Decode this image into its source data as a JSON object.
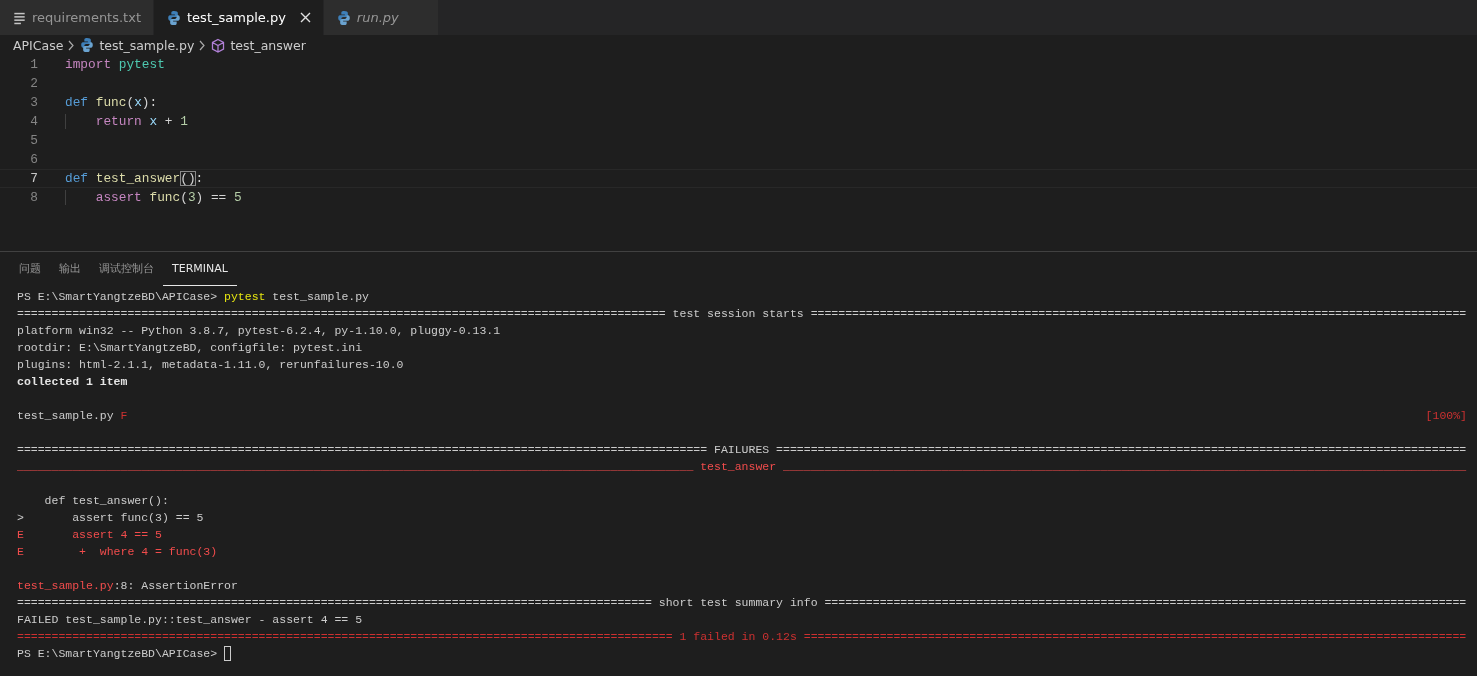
{
  "tabs": [
    {
      "label": "requirements.txt",
      "kind": "text",
      "selected": false,
      "preview": false,
      "closable": false
    },
    {
      "label": "test_sample.py",
      "kind": "python",
      "selected": true,
      "preview": false,
      "closable": true
    },
    {
      "label": "run.py",
      "kind": "python",
      "selected": false,
      "preview": true,
      "closable": false
    }
  ],
  "breadcrumbs": [
    {
      "label": "APICase",
      "kind": "folder"
    },
    {
      "label": "test_sample.py",
      "kind": "python"
    },
    {
      "label": "test_answer",
      "kind": "symbol"
    }
  ],
  "code_lines": [
    {
      "number": "1",
      "current": false,
      "tokens": [
        {
          "kind": "keyword",
          "text": "import "
        },
        {
          "kind": "module",
          "text": "pytest"
        }
      ]
    },
    {
      "number": "2",
      "current": false
    },
    {
      "number": "3",
      "current": false,
      "tokens": [
        {
          "kind": "storage",
          "text": "def "
        },
        {
          "kind": "function",
          "text": "func"
        },
        {
          "kind": "plain",
          "text": "("
        },
        {
          "kind": "param",
          "text": "x"
        },
        {
          "kind": "plain",
          "text": "):"
        }
      ]
    },
    {
      "number": "4",
      "current": false,
      "tokens": [
        {
          "kind": "indented-keyword",
          "text": "    return "
        },
        {
          "kind": "param",
          "text": "x"
        },
        {
          "kind": "plain",
          "text": " + "
        },
        {
          "kind": "number",
          "text": "1"
        }
      ]
    },
    {
      "number": "5",
      "current": false
    },
    {
      "number": "6",
      "current": false
    },
    {
      "number": "7",
      "current": true,
      "tokens": [
        {
          "kind": "storage",
          "text": "def "
        },
        {
          "kind": "function",
          "text": "test_answer"
        },
        {
          "kind": "bracket-match",
          "text": "()"
        },
        {
          "kind": "plain",
          "text": ":"
        }
      ]
    },
    {
      "number": "8",
      "current": false,
      "tokens": [
        {
          "kind": "indented-keyword",
          "text": "    assert "
        },
        {
          "kind": "function",
          "text": "func"
        },
        {
          "kind": "plain",
          "text": "("
        },
        {
          "kind": "number",
          "text": "3"
        },
        {
          "kind": "plain",
          "text": ") == "
        },
        {
          "kind": "number",
          "text": "5"
        }
      ]
    }
  ],
  "panel_tabs": [
    {
      "label": "问题",
      "selected": false
    },
    {
      "label": "输出",
      "selected": false
    },
    {
      "label": "调试控制台",
      "selected": false
    },
    {
      "label": "TERMINAL",
      "selected": true
    }
  ],
  "terminal_lines": [
    {
      "kind": "prompt",
      "cursor": false,
      "segments": [
        {
          "kind": "plain",
          "text": "PS E:\\SmartYangtzeBD\\APICase> "
        },
        {
          "kind": "yellow",
          "text": "pytest"
        },
        {
          "kind": "plain",
          "text": " test_sample.py"
        }
      ]
    },
    {
      "kind": "text",
      "segments": [
        {
          "kind": "plain",
          "text": "============================================================================================== test session starts ==============================================================================================="
        }
      ]
    },
    {
      "kind": "text",
      "segments": [
        {
          "kind": "plain",
          "text": "platform win32 -- Python 3.8.7, pytest-6.2.4, py-1.10.0, pluggy-0.13.1"
        }
      ]
    },
    {
      "kind": "text",
      "segments": [
        {
          "kind": "plain",
          "text": "rootdir: E:\\SmartYangtzeBD, configfile: pytest.ini"
        }
      ]
    },
    {
      "kind": "text",
      "segments": [
        {
          "kind": "plain",
          "text": "plugins: html-2.1.1, metadata-1.11.0, rerunfailures-10.0"
        }
      ]
    },
    {
      "kind": "text",
      "segments": [
        {
          "kind": "bold",
          "text": "collected 1 item"
        }
      ]
    },
    {
      "kind": "blank"
    },
    {
      "kind": "text",
      "segments": [
        {
          "kind": "plain",
          "text": "test_sample.py "
        },
        {
          "kind": "red",
          "text": "F"
        }
      ],
      "right": [
        {
          "kind": "red",
          "text": "[100%]"
        }
      ]
    },
    {
      "kind": "blank"
    },
    {
      "kind": "text",
      "segments": [
        {
          "kind": "plain",
          "text": "==================================================================================================== FAILURES ===================================================================================================="
        }
      ]
    },
    {
      "kind": "text",
      "segments": [
        {
          "kind": "bright-red",
          "text": "__________________________________________________________________________________________________ test_answer ___________________________________________________________________________________________________"
        }
      ]
    },
    {
      "kind": "blank"
    },
    {
      "kind": "text",
      "segments": [
        {
          "kind": "plain",
          "text": "    def test_answer():"
        }
      ]
    },
    {
      "kind": "text",
      "segments": [
        {
          "kind": "plain",
          "text": ">       assert func(3) == 5"
        }
      ]
    },
    {
      "kind": "text",
      "segments": [
        {
          "kind": "bright-red",
          "text": "E       assert 4 == 5"
        }
      ]
    },
    {
      "kind": "text",
      "segments": [
        {
          "kind": "bright-red",
          "text": "E        +  where 4 = func(3)"
        }
      ]
    },
    {
      "kind": "blank"
    },
    {
      "kind": "text",
      "segments": [
        {
          "kind": "bright-red",
          "text": "test_sample.py"
        },
        {
          "kind": "plain",
          "text": ":8: AssertionError"
        }
      ]
    },
    {
      "kind": "text",
      "segments": [
        {
          "kind": "plain",
          "text": "============================================================================================ short test summary info ============================================================================================="
        }
      ]
    },
    {
      "kind": "text",
      "segments": [
        {
          "kind": "plain",
          "text": "FAILED test_sample.py::test_answer - assert 4 == 5"
        }
      ]
    },
    {
      "kind": "text",
      "segments": [
        {
          "kind": "red",
          "text": "=============================================================================================== 1 failed in 0.12s ================================================================================================"
        }
      ]
    },
    {
      "kind": "prompt",
      "cursor": true,
      "segments": [
        {
          "kind": "plain",
          "text": "PS E:\\SmartYangtzeBD\\APICase> "
        }
      ]
    }
  ]
}
